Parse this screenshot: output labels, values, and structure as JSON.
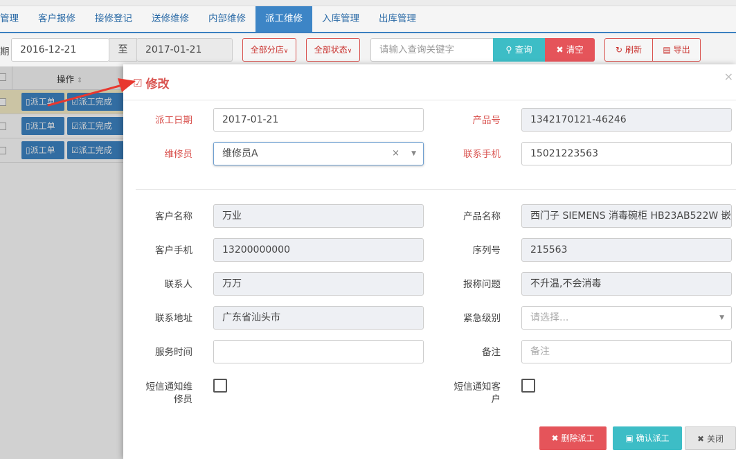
{
  "nav": {
    "tabs": [
      {
        "label": "管理"
      },
      {
        "label": "客户报修"
      },
      {
        "label": "接修登记"
      },
      {
        "label": "送修维修"
      },
      {
        "label": "内部维修"
      },
      {
        "label": "派工维修"
      },
      {
        "label": "入库管理"
      },
      {
        "label": "出库管理"
      }
    ],
    "active_tab": "派工维修"
  },
  "filter": {
    "date_label": "期",
    "start_date": "2016-12-21",
    "to_label": "至",
    "end_date": "2017-01-21",
    "branch_select": "全部分店",
    "status_select": "全部状态",
    "search_placeholder": "请输入查询关键字",
    "query_label": "查询",
    "clear_label": "清空",
    "refresh_label": "刷新",
    "export_label": "导出"
  },
  "table": {
    "ops_header": "操作",
    "rows": [
      {
        "dispatch_label": "派工单",
        "complete_label": "派工完成"
      },
      {
        "dispatch_label": "派工单",
        "complete_label": "派工完成"
      },
      {
        "dispatch_label": "派工单",
        "complete_label": "派工完成"
      }
    ]
  },
  "modal": {
    "title": "修改",
    "close_symbol": "×",
    "fields": {
      "dispatch_date": {
        "label": "派工日期",
        "value": "2017-01-21"
      },
      "product_no": {
        "label": "产品号",
        "value": "1342170121-46246"
      },
      "technician": {
        "label": "维修员",
        "value": "维修员A"
      },
      "contact_phone": {
        "label": "联系手机",
        "value": "15021223563"
      },
      "customer_name": {
        "label": "客户名称",
        "value": "万业"
      },
      "product_name": {
        "label": "产品名称",
        "value": "西门子   SIEMENS 消毒碗柜 HB23AB522W 嵌"
      },
      "customer_phone": {
        "label": "客户手机",
        "value": "13200000000"
      },
      "serial_no": {
        "label": "序列号",
        "value": "215563"
      },
      "contact_person": {
        "label": "联系人",
        "value": "万万"
      },
      "reported_issue": {
        "label": "报称问题",
        "value": "不升温,不会消毒"
      },
      "address": {
        "label": "联系地址",
        "value": "广东省汕头市"
      },
      "urgency": {
        "label": "紧急级别",
        "placeholder": "请选择..."
      },
      "service_time": {
        "label": "服务时间",
        "value": ""
      },
      "remarks": {
        "label": "备注",
        "placeholder": "备注"
      },
      "sms_technician": {
        "label_line1": "短信通知维",
        "label_line2": "修员"
      },
      "sms_customer": {
        "label_line1": "短信通知客",
        "label_line2": "户"
      }
    },
    "buttons": {
      "delete": "删除派工",
      "confirm": "确认派工",
      "close": "关闭"
    }
  },
  "colors": {
    "primary": "#3d85c6",
    "danger": "#e5545a",
    "info": "#3dbdc6",
    "required_label": "#d9534f",
    "arrow": "#e8382f"
  }
}
